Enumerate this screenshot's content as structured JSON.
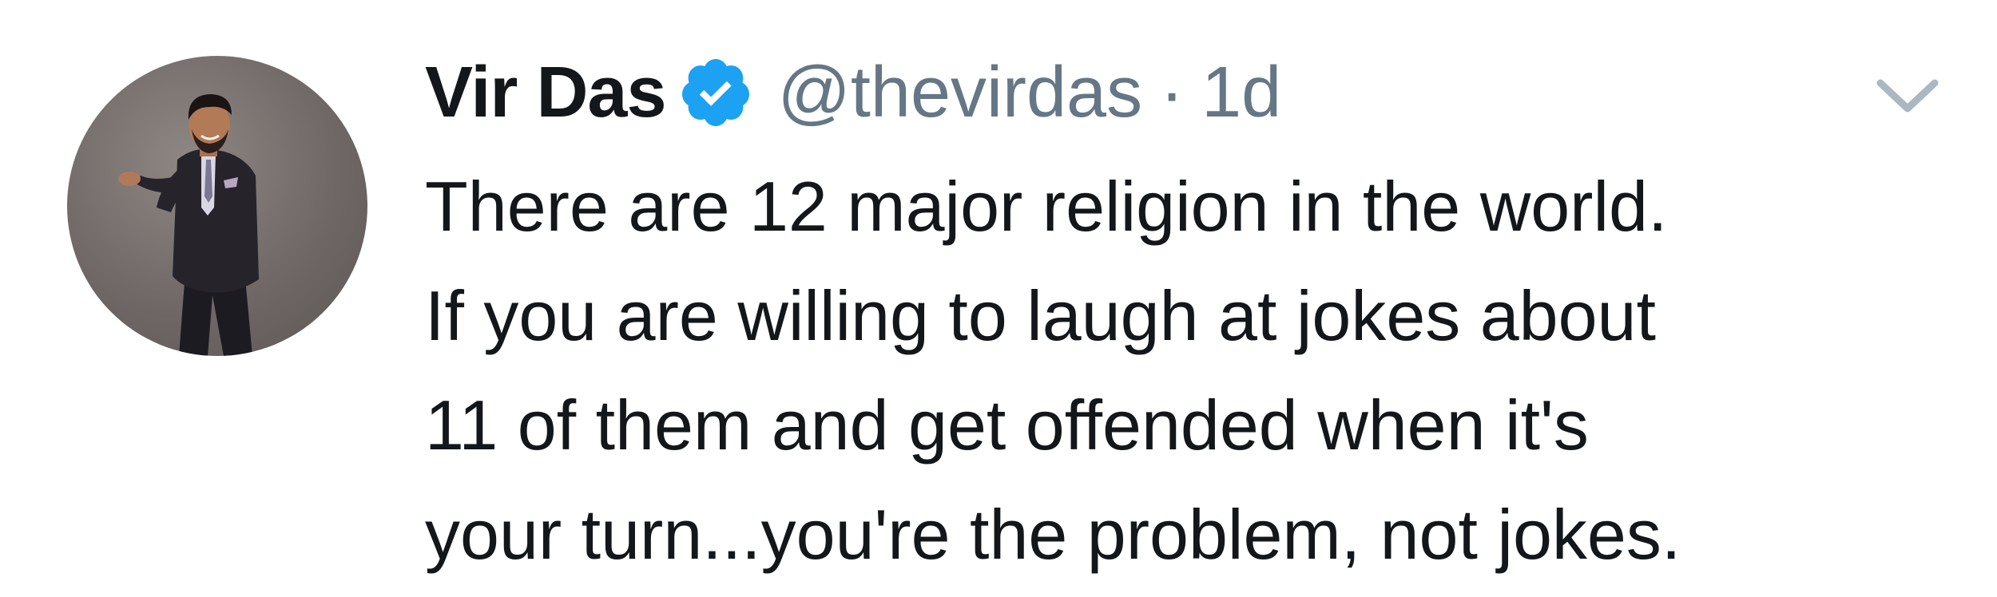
{
  "tweet": {
    "author": {
      "name": "Vir Das",
      "handle": "@thevirdas",
      "verified": true
    },
    "separator": "·",
    "timestamp": "1d",
    "text_lines": [
      "There are 12 major religion in the world.",
      "If you are willing to laugh at jokes about",
      "11 of them and get offended when it's",
      "your turn...you're the problem, not jokes."
    ],
    "icons": {
      "verified": "verified-badge-icon",
      "menu": "chevron-down-icon"
    },
    "colors": {
      "text": "#14171a",
      "secondary": "#657786",
      "verified_blue": "#1da1f2",
      "caret": "#aab8c2"
    }
  }
}
